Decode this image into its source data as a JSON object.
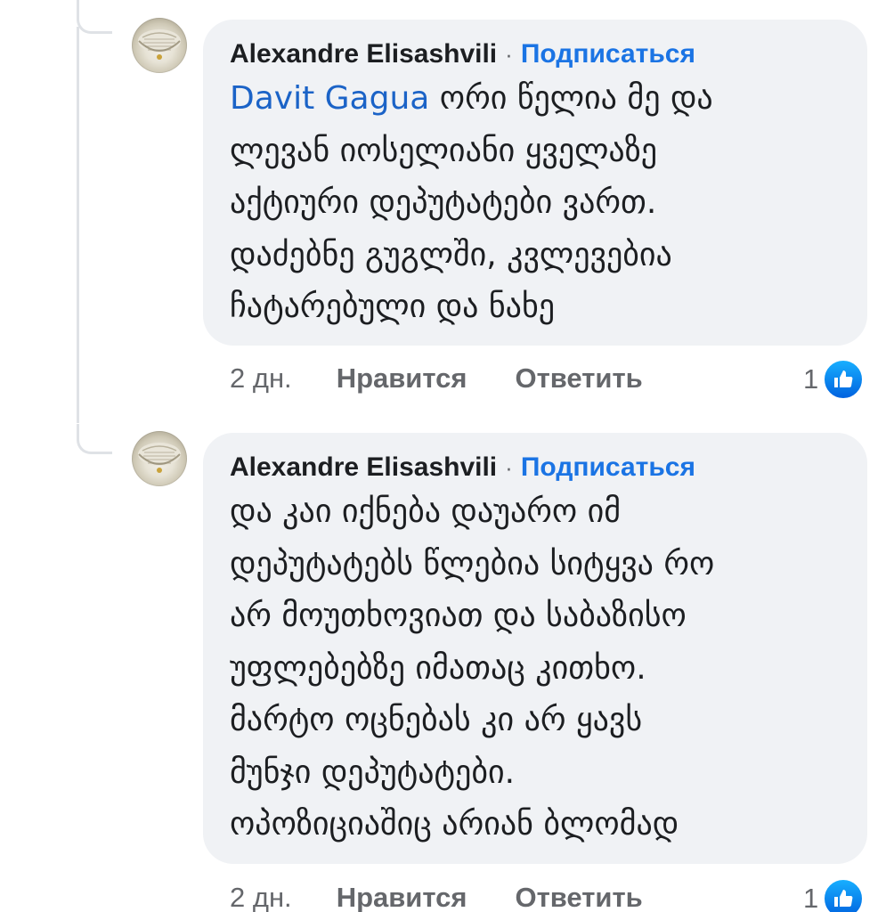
{
  "comments": [
    {
      "author": "Alexandre Elisashvili",
      "separator": "·",
      "follow_label": "Подписаться",
      "mention": "Davit Gagua",
      "text": " ორი წელია მე და\nლევან იოსელიანი ყველაზე\nაქტიური დეპუტატები ვართ.\nდაძებნე გუგლში, კვლევებია\nჩატარებული და ნახე",
      "time": "2 дн.",
      "like_label": "Нравится",
      "reply_label": "Ответить",
      "reaction_count": "1",
      "reaction_icon": "like-icon",
      "avatar_icon": "chandelier-avatar-icon"
    },
    {
      "author": "Alexandre Elisashvili",
      "separator": "·",
      "follow_label": "Подписаться",
      "mention": "",
      "text": "და კაი იქნება დაუარო იმ\nდეპუტატებს წლებია სიტყვა რო\nარ მოუთხოვიათ და საბაზისო\nუფლებებზე იმათაც კითხო.\nმარტო ოცნებას კი არ ყავს\nმუნჯი დეპუტატები.\nოპოზიციაშიც არიან ბლომად",
      "time": "2 дн.",
      "like_label": "Нравится",
      "reply_label": "Ответить",
      "reaction_count": "1",
      "reaction_icon": "like-icon",
      "avatar_icon": "chandelier-avatar-icon"
    }
  ],
  "colors": {
    "bubble_bg": "#f0f2f5",
    "link_blue": "#1b74e4",
    "text": "#1c1e21",
    "meta_gray": "#65676b",
    "like_blue": "#1877f2"
  }
}
